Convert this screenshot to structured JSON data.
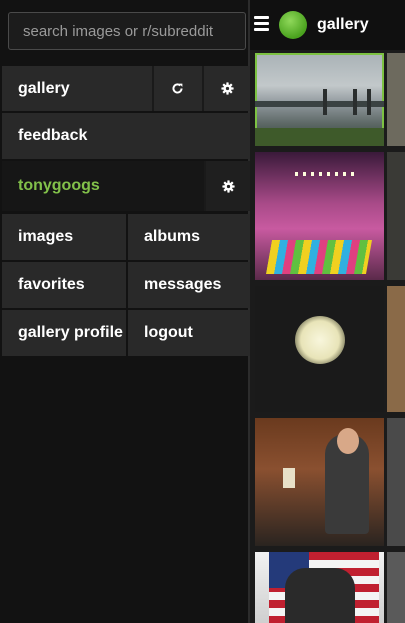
{
  "search": {
    "placeholder": "search images or r/subreddit"
  },
  "topbar": {
    "brand": "gallery",
    "menu_icon": "hamburger-icon",
    "logo": "green-circle-logo"
  },
  "drawer": {
    "gallery_row": {
      "label": "gallery",
      "refresh_icon": "refresh-icon",
      "settings_icon": "gear-icon"
    },
    "feedback_row": {
      "label": "feedback"
    },
    "user_row": {
      "label": "tonygoogs",
      "settings_icon": "gear-icon"
    },
    "menu": [
      {
        "left": "images",
        "right": "albums"
      },
      {
        "left": "favorites",
        "right": "messages"
      },
      {
        "left": "gallery profile",
        "right": "logout"
      }
    ]
  },
  "colors": {
    "accent": "#82c14a",
    "drawer_bg": "#121212",
    "item_bg": "#292929",
    "selected_outline": "#7dc242"
  }
}
